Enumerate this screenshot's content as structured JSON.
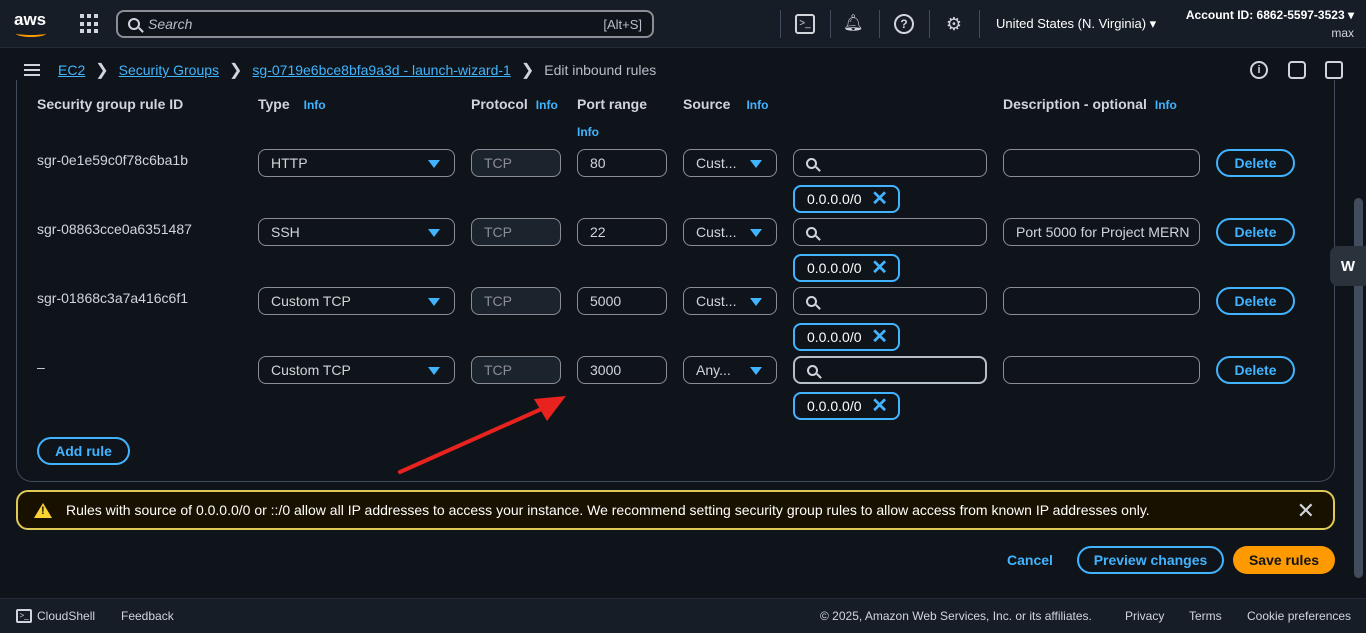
{
  "topbar": {
    "logo": "aws",
    "search_placeholder": "Search",
    "search_shortcut": "[Alt+S]",
    "region": "United States (N. Virginia)",
    "account_id": "Account ID: 6862-5597-3523",
    "user": "max"
  },
  "breadcrumb": {
    "items": [
      "EC2",
      "Security Groups",
      "sg-0719e6bce8bfa9a3d - launch-wizard-1"
    ],
    "current": "Edit inbound rules"
  },
  "table": {
    "headers": {
      "rule_id": "Security group rule ID",
      "type": "Type",
      "protocol": "Protocol",
      "port_range": "Port range",
      "source": "Source",
      "description": "Description - optional",
      "info": "Info"
    },
    "rows": [
      {
        "rule_id": "sgr-0e1e59c0f78c6ba1b",
        "type": "HTTP",
        "protocol": "TCP",
        "port": "80",
        "source": "Cust...",
        "search": "",
        "token": "0.0.0.0/0",
        "description": "",
        "delete": "Delete"
      },
      {
        "rule_id": "sgr-08863cce0a6351487",
        "type": "SSH",
        "protocol": "TCP",
        "port": "22",
        "source": "Cust...",
        "search": "",
        "token": "0.0.0.0/0",
        "description": "Port 5000 for Project MERN",
        "delete": "Delete"
      },
      {
        "rule_id": "sgr-01868c3a7a416c6f1",
        "type": "Custom TCP",
        "protocol": "TCP",
        "port": "5000",
        "source": "Cust...",
        "search": "",
        "token": "0.0.0.0/0",
        "description": "",
        "delete": "Delete"
      },
      {
        "rule_id": "–",
        "type": "Custom TCP",
        "protocol": "TCP",
        "port": "3000",
        "source": "Any...",
        "search": "",
        "token": "0.0.0.0/0",
        "description": "",
        "delete": "Delete"
      }
    ],
    "add_rule": "Add rule"
  },
  "warning": {
    "text": "Rules with source of 0.0.0.0/0 or ::/0 allow all IP addresses to access your instance. We recommend setting security group rules to allow access from known IP addresses only."
  },
  "actions": {
    "cancel": "Cancel",
    "preview": "Preview changes",
    "save": "Save rules"
  },
  "footer": {
    "cloudshell": "CloudShell",
    "feedback": "Feedback",
    "copyright": "© 2025, Amazon Web Services, Inc. or its affiliates.",
    "privacy": "Privacy",
    "terms": "Terms",
    "cookies": "Cookie preferences"
  },
  "side_tab": "W",
  "colors": {
    "accent": "#42b4ff",
    "primary_button": "#ff9900",
    "warning_border": "#e0ca57",
    "annotation_arrow": "#e8231f"
  }
}
